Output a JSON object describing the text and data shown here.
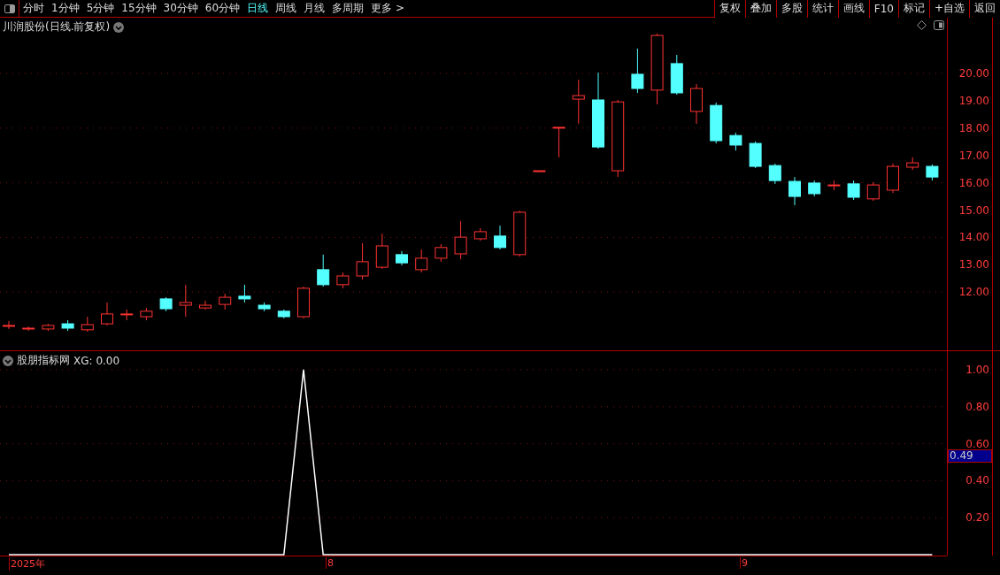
{
  "toolbar": {
    "tabs": [
      {
        "label": "分时",
        "selected": false
      },
      {
        "label": "1分钟",
        "selected": false
      },
      {
        "label": "5分钟",
        "selected": false
      },
      {
        "label": "15分钟",
        "selected": false
      },
      {
        "label": "30分钟",
        "selected": false
      },
      {
        "label": "60分钟",
        "selected": false
      },
      {
        "label": "日线",
        "selected": true
      },
      {
        "label": "周线",
        "selected": false
      },
      {
        "label": "月线",
        "selected": false
      },
      {
        "label": "多周期",
        "selected": false
      },
      {
        "label": "更多 >",
        "selected": false
      }
    ],
    "buttons": [
      "复权",
      "叠加",
      "多股",
      "统计",
      "画线",
      "F10",
      "标记",
      "+自选",
      "返回"
    ]
  },
  "price_pane": {
    "title": "川润股份(日线.前复权)",
    "chart_data": {
      "type": "candlestick",
      "grid": true,
      "ylim": [
        9.87,
        22.04
      ],
      "yticks": [
        {
          "value": 20,
          "label": "20.00"
        },
        {
          "value": 19,
          "label": "19.00"
        },
        {
          "value": 18,
          "label": "18.00"
        },
        {
          "value": 17,
          "label": "17.00"
        },
        {
          "value": 16,
          "label": "16.00"
        },
        {
          "value": 15,
          "label": "15.00"
        },
        {
          "value": 14,
          "label": "14.00"
        },
        {
          "value": 13,
          "label": "13.00"
        },
        {
          "value": 12,
          "label": "12.00"
        }
      ],
      "ohlc": [
        [
          10.78,
          10.94,
          10.65,
          10.78
        ],
        [
          10.65,
          10.74,
          10.58,
          10.68
        ],
        [
          10.65,
          10.84,
          10.58,
          10.78
        ],
        [
          10.84,
          10.97,
          10.58,
          10.68
        ],
        [
          10.62,
          11.1,
          10.55,
          10.81
        ],
        [
          10.84,
          11.62,
          10.78,
          11.2
        ],
        [
          11.2,
          11.36,
          10.97,
          11.2
        ],
        [
          11.1,
          11.42,
          10.97,
          11.3
        ],
        [
          11.75,
          11.81,
          11.3,
          11.39
        ],
        [
          11.52,
          12.27,
          11.1,
          11.62
        ],
        [
          11.42,
          11.68,
          11.36,
          11.52
        ],
        [
          11.55,
          11.94,
          11.36,
          11.81
        ],
        [
          11.85,
          12.27,
          11.62,
          11.75
        ],
        [
          11.52,
          11.62,
          11.3,
          11.39
        ],
        [
          11.3,
          11.36,
          11.04,
          11.1
        ],
        [
          11.1,
          12.2,
          11.04,
          12.14
        ],
        [
          12.82,
          13.37,
          12.2,
          12.27
        ],
        [
          12.27,
          12.72,
          12.14,
          12.59
        ],
        [
          12.59,
          13.79,
          12.46,
          13.11
        ],
        [
          12.91,
          14.14,
          12.85,
          13.69
        ],
        [
          13.37,
          13.5,
          12.98,
          13.07
        ],
        [
          12.82,
          13.56,
          12.72,
          13.24
        ],
        [
          13.24,
          13.75,
          13.11,
          13.63
        ],
        [
          13.4,
          14.6,
          13.2,
          14.01
        ],
        [
          13.95,
          14.34,
          13.88,
          14.21
        ],
        [
          14.05,
          14.43,
          13.56,
          13.63
        ],
        [
          13.37,
          14.98,
          13.3,
          14.92
        ],
        [
          16.44,
          16.44,
          16.41,
          16.44
        ],
        [
          18.03,
          18.03,
          16.93,
          18.03
        ],
        [
          19.06,
          19.77,
          18.16,
          19.19
        ],
        [
          19.03,
          20.03,
          17.25,
          17.31
        ],
        [
          16.44,
          19.03,
          16.21,
          18.96
        ],
        [
          19.97,
          20.91,
          19.29,
          19.45
        ],
        [
          19.39,
          21.46,
          18.87,
          21.39
        ],
        [
          20.36,
          20.68,
          19.22,
          19.29
        ],
        [
          18.61,
          19.61,
          18.16,
          19.45
        ],
        [
          18.83,
          18.93,
          17.44,
          17.54
        ],
        [
          17.73,
          17.83,
          17.18,
          17.38
        ],
        [
          17.44,
          17.51,
          16.54,
          16.6
        ],
        [
          16.63,
          16.7,
          15.96,
          16.08
        ],
        [
          16.05,
          16.21,
          15.18,
          15.5
        ],
        [
          15.99,
          16.08,
          15.5,
          15.6
        ],
        [
          15.92,
          16.08,
          15.73,
          15.92
        ],
        [
          15.96,
          16.08,
          15.37,
          15.47
        ],
        [
          15.41,
          16.02,
          15.34,
          15.92
        ],
        [
          15.73,
          16.7,
          15.63,
          16.6
        ],
        [
          16.57,
          16.93,
          16.47,
          16.73
        ],
        [
          16.6,
          16.67,
          16.08,
          16.21
        ]
      ]
    }
  },
  "indicator_pane": {
    "title": "股朋指标网",
    "reading": "XG: 0.00",
    "cursor_value": "0.49",
    "chart_data": {
      "type": "line",
      "grid": true,
      "ylim": [
        0,
        1.1
      ],
      "yticks": [
        {
          "value": 1,
          "label": "1.00"
        },
        {
          "value": 0.8,
          "label": "0.80"
        },
        {
          "value": 0.6,
          "label": "0.60"
        },
        {
          "value": 0.4,
          "label": "0.40"
        },
        {
          "value": 0.2,
          "label": "0.20"
        }
      ],
      "series": [
        {
          "color": "#ffffff",
          "values": [
            0,
            0,
            0,
            0,
            0,
            0,
            0,
            0,
            0,
            0,
            0,
            0,
            0,
            0,
            0,
            1,
            0,
            0,
            0,
            0,
            0,
            0,
            0,
            0,
            0,
            0,
            0,
            0,
            0,
            0,
            0,
            0,
            0,
            0,
            0,
            0,
            0,
            0,
            0,
            0,
            0,
            0,
            0,
            0,
            0,
            0,
            0,
            0
          ]
        }
      ]
    }
  },
  "date_axis": [
    "2025年",
    "8",
    "9"
  ]
}
